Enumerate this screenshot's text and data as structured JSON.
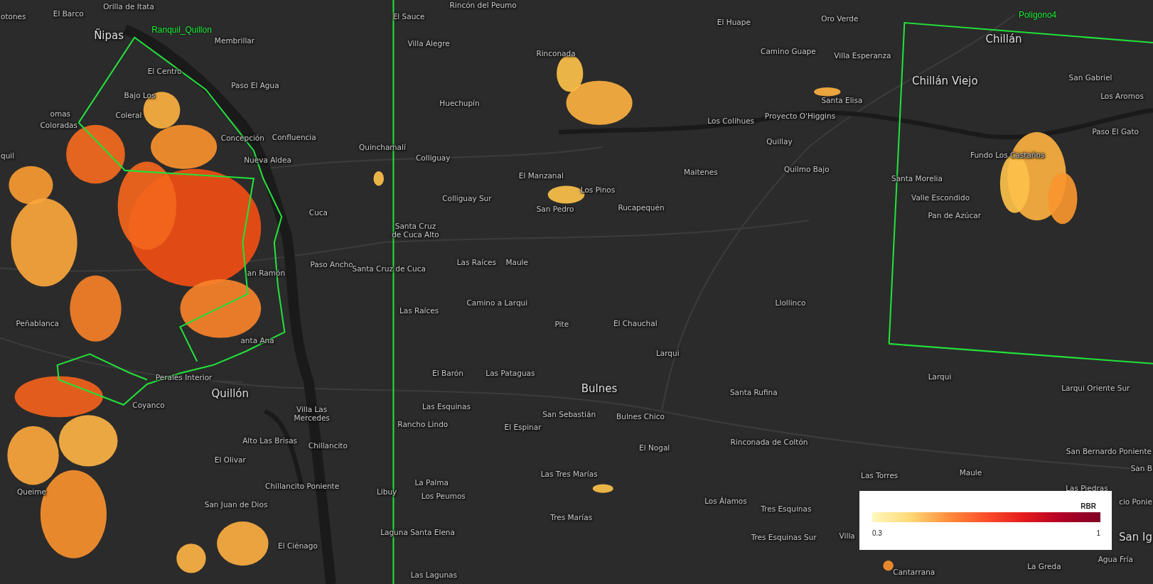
{
  "map": {
    "places": [
      {
        "name": "Orilla de Itata",
        "kind": "town"
      },
      {
        "name": "Rincón del Peumo",
        "kind": "town"
      },
      {
        "name": "otones",
        "kind": "town"
      },
      {
        "name": "El Barco",
        "kind": "town"
      },
      {
        "name": "El Sauce",
        "kind": "town"
      },
      {
        "name": "El Huape",
        "kind": "town"
      },
      {
        "name": "Oro Verde",
        "kind": "town"
      },
      {
        "name": "Ñipas",
        "kind": "city"
      },
      {
        "name": "Membrillar",
        "kind": "town"
      },
      {
        "name": "Chillán",
        "kind": "city"
      },
      {
        "name": "Villa Alegre",
        "kind": "town"
      },
      {
        "name": "Rinconada",
        "kind": "town"
      },
      {
        "name": "Camino Guape",
        "kind": "town"
      },
      {
        "name": "Villa Esperanza",
        "kind": "town"
      },
      {
        "name": "El Centro",
        "kind": "town"
      },
      {
        "name": "Chillán Viejo",
        "kind": "city"
      },
      {
        "name": "San Gabriel",
        "kind": "town"
      },
      {
        "name": "Paso El Agua",
        "kind": "town"
      },
      {
        "name": "Bajo Los",
        "kind": "town"
      },
      {
        "name": "Los Aromos",
        "kind": "town"
      },
      {
        "name": "Huechupín",
        "kind": "town"
      },
      {
        "name": "Santa Elisa",
        "kind": "town"
      },
      {
        "name": "omas",
        "kind": "town"
      },
      {
        "name": "Coleral",
        "kind": "town"
      },
      {
        "name": "Los Colihues",
        "kind": "town"
      },
      {
        "name": "Proyecto O'Higgins",
        "kind": "town"
      },
      {
        "name": "Coloradas",
        "kind": "town"
      },
      {
        "name": "Paso El Gato",
        "kind": "town"
      },
      {
        "name": "Concepción",
        "kind": "town"
      },
      {
        "name": "Confluencia",
        "kind": "town"
      },
      {
        "name": "Quillay",
        "kind": "town"
      },
      {
        "name": "Quinchamalí",
        "kind": "town"
      },
      {
        "name": "quil",
        "kind": "town"
      },
      {
        "name": "Nueva Aldea",
        "kind": "town"
      },
      {
        "name": "Colliguay",
        "kind": "town"
      },
      {
        "name": "Fundo Los Castaños",
        "kind": "town"
      },
      {
        "name": "El Manzanal",
        "kind": "town"
      },
      {
        "name": "Maitenes",
        "kind": "town"
      },
      {
        "name": "Quilmo Bajo",
        "kind": "town"
      },
      {
        "name": "Santa Morelia",
        "kind": "town"
      },
      {
        "name": "Los Pinos",
        "kind": "town"
      },
      {
        "name": "Colliguay Sur",
        "kind": "town"
      },
      {
        "name": "Valle Escondido",
        "kind": "town"
      },
      {
        "name": "San Pedro",
        "kind": "town"
      },
      {
        "name": "Rucapequén",
        "kind": "town"
      },
      {
        "name": "Cuca",
        "kind": "town"
      },
      {
        "name": "Pan de Azúcar",
        "kind": "town"
      },
      {
        "name": "Santa Cruz de Cuca Alto",
        "kind": "town"
      },
      {
        "name": "an Ramón",
        "kind": "town"
      },
      {
        "name": "Paso Ancho",
        "kind": "town"
      },
      {
        "name": "Santa Cruz de Cuca",
        "kind": "town"
      },
      {
        "name": "Las Raíces",
        "kind": "town"
      },
      {
        "name": "Maule",
        "kind": "town"
      },
      {
        "name": "Camino a Larqui",
        "kind": "town"
      },
      {
        "name": "Llollinco",
        "kind": "town"
      },
      {
        "name": "Las Raíces",
        "kind": "town"
      },
      {
        "name": "Peñablanca",
        "kind": "town"
      },
      {
        "name": "Pite",
        "kind": "town"
      },
      {
        "name": "El Chauchal",
        "kind": "town"
      },
      {
        "name": "anta Ana",
        "kind": "town"
      },
      {
        "name": "Larqui",
        "kind": "town"
      },
      {
        "name": "Perales Interior",
        "kind": "town"
      },
      {
        "name": "El Barón",
        "kind": "town"
      },
      {
        "name": "Las Pataguas",
        "kind": "town"
      },
      {
        "name": "Larqui",
        "kind": "town"
      },
      {
        "name": "Quillón",
        "kind": "city"
      },
      {
        "name": "Bulnes",
        "kind": "city"
      },
      {
        "name": "Santa Rufina",
        "kind": "town"
      },
      {
        "name": "Larqui Oriente Sur",
        "kind": "town"
      },
      {
        "name": "Coyanco",
        "kind": "town"
      },
      {
        "name": "Las Esquinas",
        "kind": "town"
      },
      {
        "name": "Villa Las Mercedes",
        "kind": "town"
      },
      {
        "name": "San Sebastián",
        "kind": "town"
      },
      {
        "name": "Bulnes Chico",
        "kind": "town"
      },
      {
        "name": "Rancho Lindo",
        "kind": "town"
      },
      {
        "name": "El Espinar",
        "kind": "town"
      },
      {
        "name": "Alto Las Brisas",
        "kind": "town"
      },
      {
        "name": "Chillancito",
        "kind": "town"
      },
      {
        "name": "El Nogal",
        "kind": "town"
      },
      {
        "name": "Rinconada de Coltón",
        "kind": "town"
      },
      {
        "name": "San Bernardo Poniente",
        "kind": "town"
      },
      {
        "name": "El Olivar",
        "kind": "town"
      },
      {
        "name": "Las Tres Marías",
        "kind": "town"
      },
      {
        "name": "Las Torres",
        "kind": "town"
      },
      {
        "name": "Maule",
        "kind": "town"
      },
      {
        "name": "San B",
        "kind": "town"
      },
      {
        "name": "Chillancito Poniente",
        "kind": "town"
      },
      {
        "name": "La Palma",
        "kind": "town"
      },
      {
        "name": "Las Piedras",
        "kind": "town"
      },
      {
        "name": "Queime",
        "kind": "town"
      },
      {
        "name": "Libuy",
        "kind": "town"
      },
      {
        "name": "Los Peumos",
        "kind": "town"
      },
      {
        "name": "San Juan de Dios",
        "kind": "town"
      },
      {
        "name": "Los Álamos",
        "kind": "town"
      },
      {
        "name": "Tres Esquinas",
        "kind": "town"
      },
      {
        "name": "cio Ponie",
        "kind": "town"
      },
      {
        "name": "Tres Marías",
        "kind": "town"
      },
      {
        "name": "Laguna Santa Elena",
        "kind": "town"
      },
      {
        "name": "Tres Esquinas Sur",
        "kind": "town"
      },
      {
        "name": "Villa",
        "kind": "town"
      },
      {
        "name": "San Ig",
        "kind": "city"
      },
      {
        "name": "El Ciénago",
        "kind": "town"
      },
      {
        "name": "Agua Fría",
        "kind": "town"
      },
      {
        "name": "Las Lagunas",
        "kind": "town"
      },
      {
        "name": "Cantarrana",
        "kind": "town"
      },
      {
        "name": "La Greda",
        "kind": "town"
      }
    ],
    "areas": [
      {
        "name": "Poligono4"
      },
      {
        "name": "Ranquil_Quillon"
      }
    ],
    "legend": {
      "title": "RBR",
      "min_label": "0.3",
      "max_label": "1"
    }
  }
}
